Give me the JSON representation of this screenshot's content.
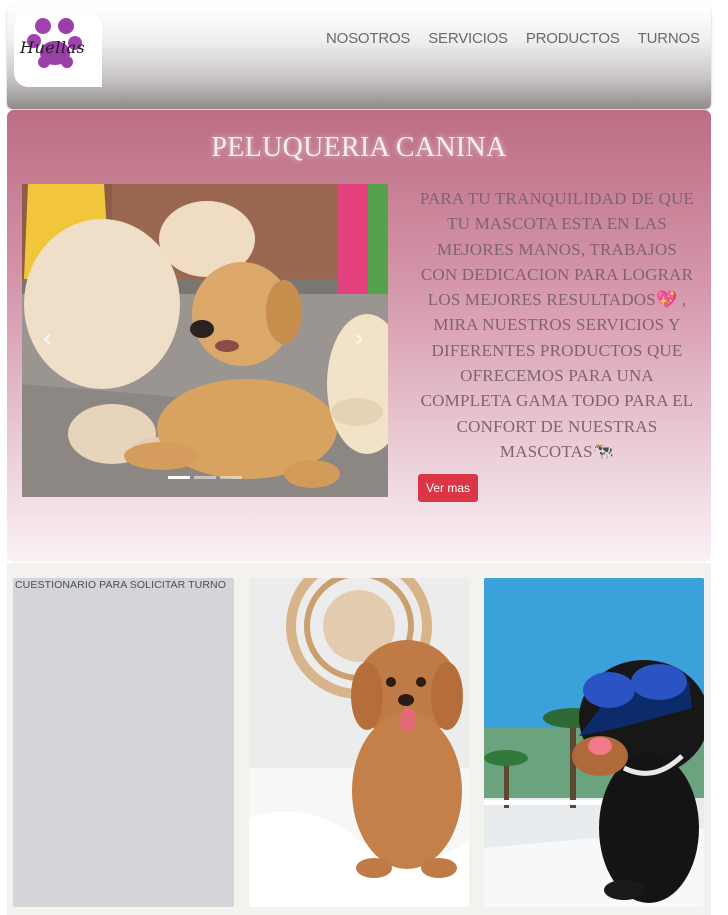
{
  "brand": {
    "logo_text": "Huellas"
  },
  "nav": {
    "items": [
      {
        "label": "NOSOTROS"
      },
      {
        "label": "SERVICIOS"
      },
      {
        "label": "PRODUCTOS"
      },
      {
        "label": "TURNOS"
      }
    ]
  },
  "hero": {
    "title": "PELUQUERIA CANINA",
    "text": "PARA TU TRANQUILIDAD DE QUE TU MASCOTA ESTA EN LAS MEJORES MANOS, TRABAJOS CON DEDICACION PARA LOGRAR LOS MEJORES RESULTADOS💖 , MIRA NUESTROS SERVICIOS Y DIFERENTES PRODUCTOS QUE OFRECEMOS PARA UNA COMPLETA GAMA TODO PARA EL CONFORT DE NUESTRAS MASCOTAS🐄",
    "button_label": "Ver mas",
    "carousel": {
      "prev_icon": "chevron-left-icon",
      "next_icon": "chevron-right-icon",
      "prev_glyph": "‹",
      "next_glyph": "›",
      "slide_count": 3,
      "active_slide": 1
    }
  },
  "cards": {
    "form_title": "CUESTIONARIO PARA SOLICITAR TURNO"
  },
  "colors": {
    "accent": "#dc3545",
    "hero_top": "#bc6d83",
    "hero_text": "#7f6370"
  }
}
